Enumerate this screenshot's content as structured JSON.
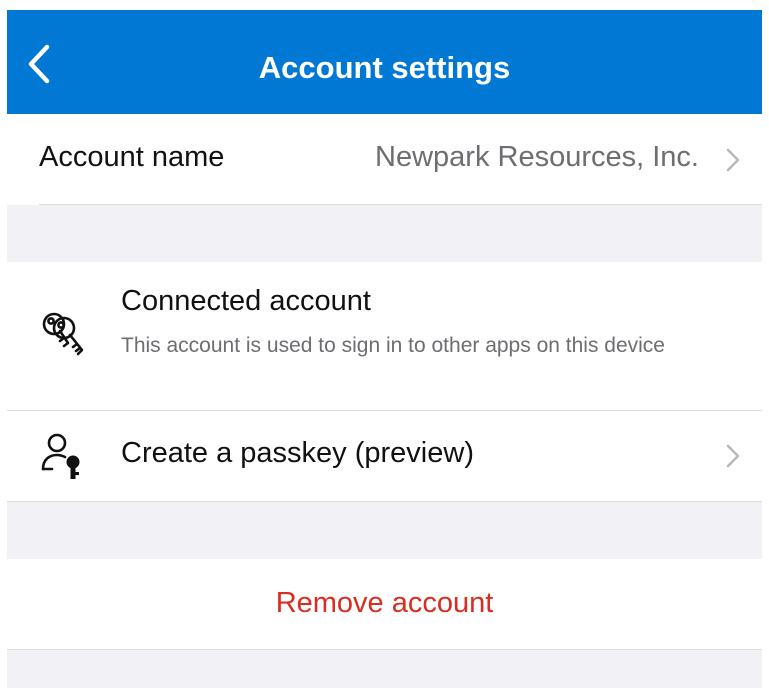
{
  "header": {
    "title": "Account settings",
    "back_icon": "chevron-left-icon",
    "background": "#0078d4"
  },
  "account_name_row": {
    "label": "Account name",
    "value": "Newpark Resources, Inc.",
    "chevron_icon": "chevron-right-icon"
  },
  "connected_account": {
    "icon": "keys-icon",
    "title": "Connected account",
    "description": "This account is used to sign in to other apps on this device"
  },
  "passkey_row": {
    "icon": "user-key-icon",
    "title": "Create a passkey (preview)",
    "chevron_icon": "chevron-right-icon"
  },
  "remove_row": {
    "label": "Remove account",
    "color": "#d92d20"
  },
  "colors": {
    "section_gap": "#f2f2f6",
    "divider": "#dcdcdc",
    "secondary_text": "#6d6d72"
  }
}
